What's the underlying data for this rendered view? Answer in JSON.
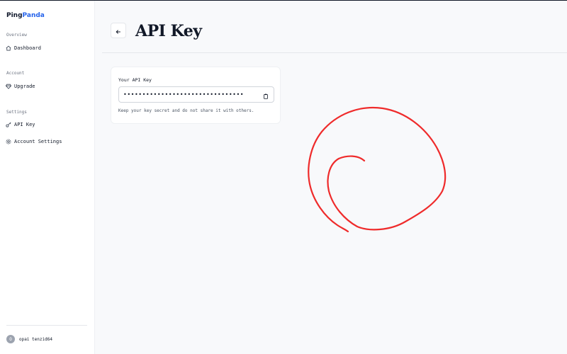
{
  "brand": {
    "part1": "Ping",
    "part2": "Panda",
    "accent_color": "#2563eb"
  },
  "sidebar": {
    "sections": [
      {
        "label": "Overview",
        "items": [
          {
            "label": "Dashboard",
            "icon": "home-icon"
          }
        ]
      },
      {
        "label": "Account",
        "items": [
          {
            "label": "Upgrade",
            "icon": "gem-icon"
          }
        ]
      },
      {
        "label": "Settings",
        "items": [
          {
            "label": "API Key",
            "icon": "key-icon"
          },
          {
            "label": "Account Settings",
            "icon": "gear-icon"
          }
        ]
      }
    ],
    "user": {
      "avatar_initial": "O",
      "name": "opai tenzid64"
    }
  },
  "header": {
    "title": "API Key",
    "back_icon": "arrow-left-icon"
  },
  "api_key_card": {
    "label": "Your API Key",
    "masked_value": "••••••••••••••••••••••••••••••••",
    "copy_icon": "clipboard-icon",
    "hint": "Keep your key secret and do not share it with others."
  },
  "annotation": {
    "color": "#ef2b2b",
    "shape": "hand-drawn-spiral-circle"
  }
}
